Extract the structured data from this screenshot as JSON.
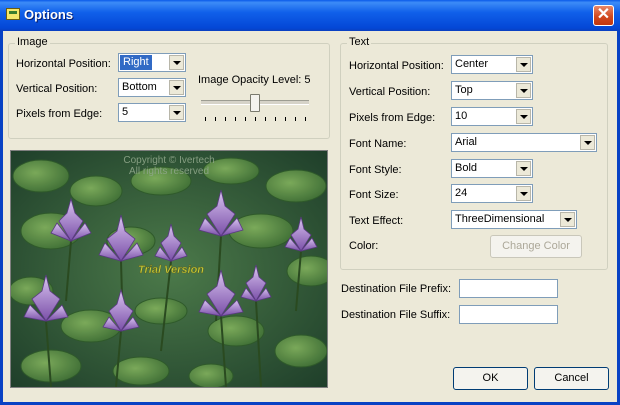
{
  "window": {
    "title": "Options"
  },
  "image_group": {
    "title": "Image",
    "horizontal_position": {
      "label": "Horizontal Position:",
      "value": "Right"
    },
    "vertical_position": {
      "label": "Vertical Position:",
      "value": "Bottom"
    },
    "pixels_from_edge": {
      "label": "Pixels from Edge:",
      "value": "5"
    },
    "opacity": {
      "label": "Image Opacity Level:",
      "value": "5"
    }
  },
  "text_group": {
    "title": "Text",
    "horizontal_position": {
      "label": "Horizontal Position:",
      "value": "Center"
    },
    "vertical_position": {
      "label": "Vertical Position:",
      "value": "Top"
    },
    "pixels_from_edge": {
      "label": "Pixels from Edge:",
      "value": "10"
    },
    "font_name": {
      "label": "Font Name:",
      "value": "Arial"
    },
    "font_style": {
      "label": "Font Style:",
      "value": "Bold"
    },
    "font_size": {
      "label": "Font Size:",
      "value": "24"
    },
    "text_effect": {
      "label": "Text Effect:",
      "value": "ThreeDimensional"
    },
    "color": {
      "label": "Color:",
      "button": "Change Color"
    }
  },
  "destination": {
    "prefix_label": "Destination File Prefix:",
    "prefix_value": "",
    "suffix_label": "Destination File Suffix:",
    "suffix_value": ""
  },
  "preview": {
    "watermark_line1": "Copyright © Ivertech",
    "watermark_line2": "All rights reserved",
    "trial_text": "Trial Version"
  },
  "buttons": {
    "ok": "OK",
    "cancel": "Cancel"
  },
  "colors": {
    "titlebar": "#0a5ae9",
    "dialog_bg": "#ece9d8",
    "selection": "#316ac5",
    "close_button": "#d1491f"
  }
}
